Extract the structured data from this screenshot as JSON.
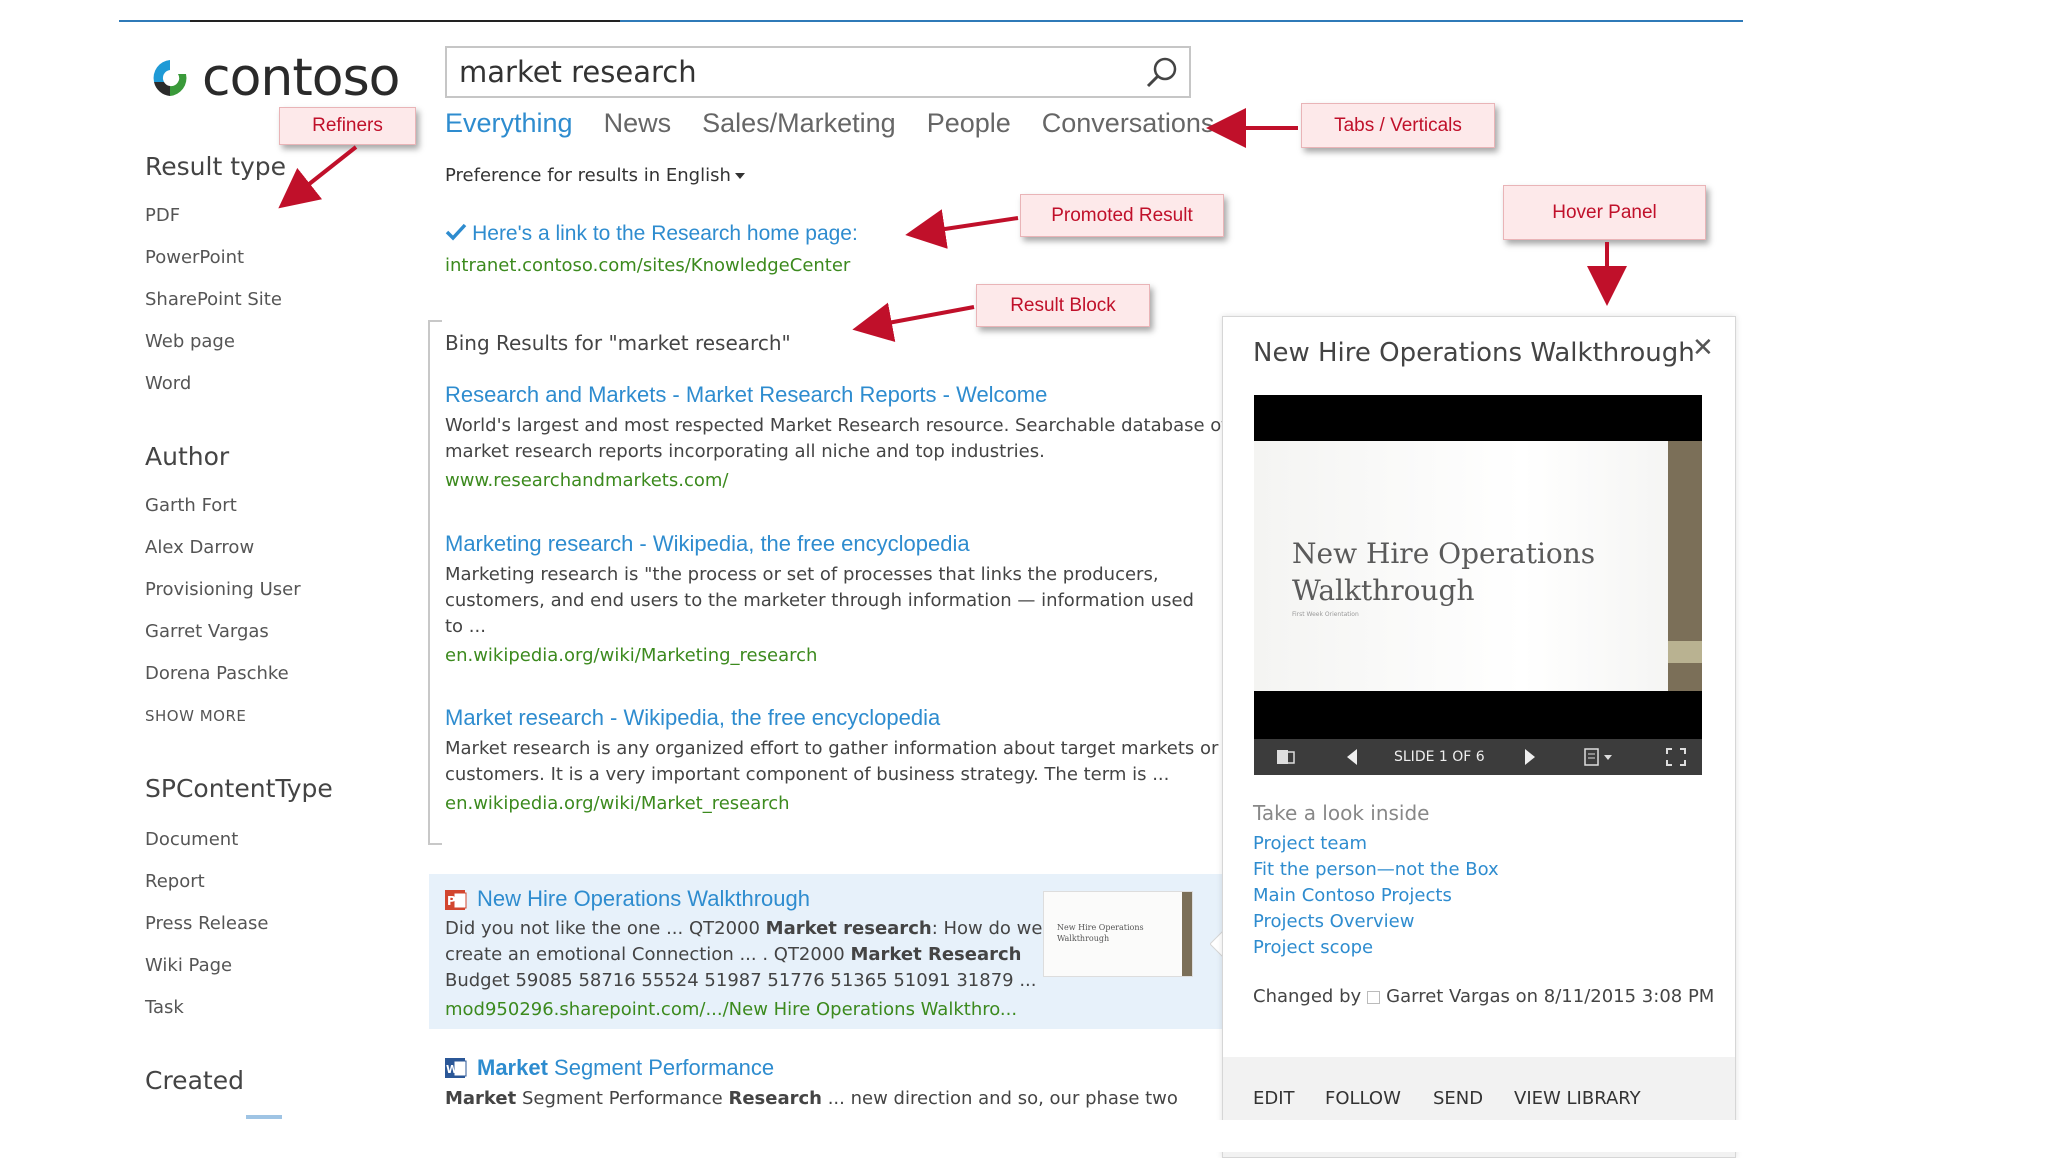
{
  "search": {
    "query": "market research"
  },
  "tabs": [
    {
      "label": "Everything",
      "active": true
    },
    {
      "label": "News"
    },
    {
      "label": "Sales/Marketing"
    },
    {
      "label": "People"
    },
    {
      "label": "Conversations"
    }
  ],
  "preference": {
    "label": "Preference for results in",
    "language": "English"
  },
  "logo": {
    "text": "contoso"
  },
  "refiners": {
    "result_type": {
      "heading": "Result type",
      "items": [
        "PDF",
        "PowerPoint",
        "SharePoint Site",
        "Web page",
        "Word"
      ]
    },
    "author": {
      "heading": "Author",
      "items": [
        "Garth Fort",
        "Alex Darrow",
        "Provisioning User",
        "Garret Vargas",
        "Dorena Paschke"
      ],
      "show_more": "SHOW MORE"
    },
    "content_type": {
      "heading": "SPContentType",
      "items": [
        "Document",
        "Report",
        "Press Release",
        "Wiki Page",
        "Task"
      ]
    },
    "created": {
      "heading": "Created"
    }
  },
  "callouts": {
    "refiners": "Refiners",
    "tabs": "Tabs / Verticals",
    "promoted": "Promoted Result",
    "block": "Result Block",
    "hover": "Hover Panel"
  },
  "promoted": {
    "title": "Here's a link to the Research home page:",
    "url": "intranet.contoso.com/sites/KnowledgeCenter"
  },
  "result_block": {
    "heading": "Bing Results for \"market research\"",
    "results": [
      {
        "title": "Research and Markets - Market Research Reports - Welcome",
        "desc_lines": [
          "World's largest and most respected Market Research resource. Searchable database of",
          "market research reports incorporating all niche and top industries."
        ],
        "url": "www.researchandmarkets.com/"
      },
      {
        "title": "Marketing research - Wikipedia, the free encyclopedia",
        "desc_lines": [
          "Marketing research is \"the process or set of processes that links the producers,",
          "customers, and end users to the marketer through information — information used",
          "to ..."
        ],
        "url": "en.wikipedia.org/wiki/Marketing_research"
      },
      {
        "title": "Market research - Wikipedia, the free encyclopedia",
        "desc_lines": [
          "Market research is any organized effort to gather information about target markets or",
          "customers. It is a very important component of business strategy. The term is ..."
        ],
        "url": "en.wikipedia.org/wiki/Market_research"
      }
    ]
  },
  "results": [
    {
      "title": "New Hire Operations Walkthrough",
      "line1_a": "Did you not like the one ... QT2000 ",
      "line1_b": "Market research",
      "line1_c": ": How do we",
      "line2_a": "create an emotional Connection ... . QT2000 ",
      "line2_b": "Market Research",
      "line3": "Budget 59085 58716 55524 51987 51776 51365 51091 31879 ...",
      "url": "mod950296.sharepoint.com/.../New Hire Operations Walkthro...",
      "thumb_text": "New Hire Operations Walkthrough"
    },
    {
      "title_a": "Market",
      "title_b": " Segment Performance",
      "line1_a": "Market",
      "line1_b": " Segment Performance ",
      "line1_c": "Research",
      "line1_d": " ... new direction and so, our phase two"
    }
  ],
  "hover_panel": {
    "title": "New Hire Operations Walkthrough",
    "close": "✕",
    "slide_title_1": "New Hire Operations",
    "slide_title_2": "Walkthrough",
    "slide_subtitle": "First Week Orientation",
    "slide_counter": "SLIDE 1 OF 6",
    "look_inside": "Take a look inside",
    "links": [
      "Project team",
      "Fit the person—not the Box",
      "Main Contoso Projects",
      "Projects Overview",
      "Project scope"
    ],
    "changed_by_label": "Changed by",
    "changed_by_name": "Garret Vargas on 8/11/2015 3:08 PM",
    "actions": [
      "EDIT",
      "FOLLOW",
      "SEND",
      "VIEW LIBRARY"
    ]
  },
  "colors": {
    "accent": "#2e8ccf",
    "url_green": "#3c8a1e",
    "callout_text": "#c0102a",
    "arrow": "#c0102a"
  }
}
